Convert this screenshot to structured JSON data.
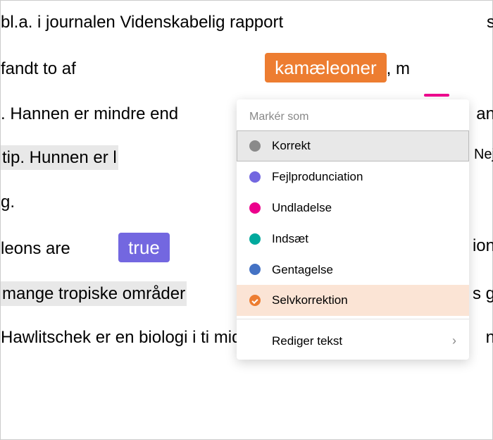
{
  "lines": {
    "l1_a": "bl.a. i journalen Videnskabelig rapport",
    "l1_b": "s",
    "l2_a": "fandt to af",
    "l2_word": "kamæleoner",
    "l2_b": ", m",
    "l3_a": ". Hannen er mindre end",
    "l3_b": "an",
    "l4_a": "tip. Hunnen er l",
    "l4_b": "Nej",
    "l5_a": "g.",
    "l6_a": "leons are ",
    "l6_word": "true",
    "l6_b": "ion",
    "l7_a": "mange tropiske områder",
    "l7_b": "s g",
    "l8_a": "Hawlitschek er en biologi i ti midte",
    "l8_b": "n"
  },
  "popup": {
    "header": "Markér som",
    "items": {
      "correct": "Korrekt",
      "mispronunciation": "Fejlprodunciation",
      "omission": "Undladelse",
      "insertion": "Indsæt",
      "repetition": "Gentagelse",
      "selfcorrection": "Selvkorrektion"
    },
    "edit": "Rediger tekst"
  }
}
